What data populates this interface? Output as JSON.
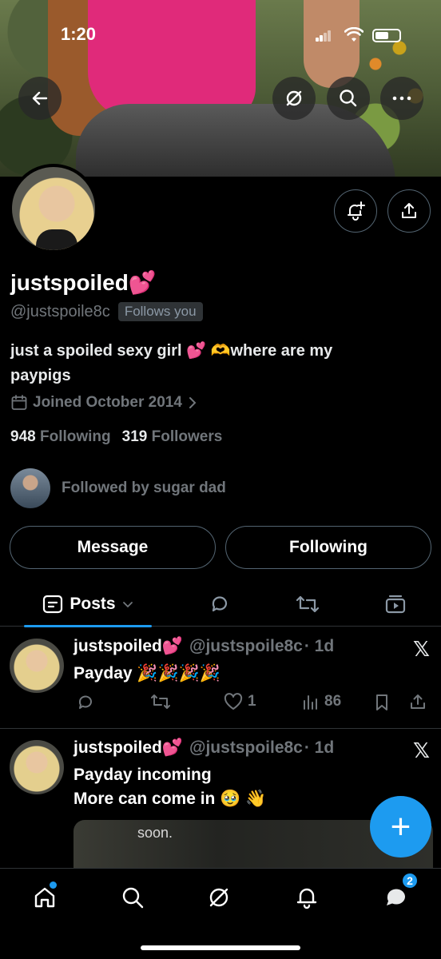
{
  "status_bar": {
    "time": "1:20"
  },
  "profile": {
    "display_name": "justspoiled💕",
    "handle": "@justspoile8c",
    "follows_you": "Follows you",
    "bio_line1": "just a spoiled sexy girl 💕 🫶where are my",
    "bio_line2": "paypigs",
    "joined": "Joined October 2014",
    "following_count": "948",
    "following_label": "Following",
    "followers_count": "319",
    "followers_label": "Followers",
    "followed_by": "Followed by sugar dad"
  },
  "buttons": {
    "message": "Message",
    "following": "Following"
  },
  "tabs": {
    "posts": "Posts"
  },
  "posts": [
    {
      "name": "justspoiled💕",
      "handle": "@justspoile8c",
      "time": "· 1d",
      "text": "Payday 🎉🎉🎉🎉",
      "likes": "1",
      "views": "86"
    },
    {
      "name": "justspoiled💕",
      "handle": "@justspoile8c",
      "time": "· 1d",
      "text_line1": "Payday incoming",
      "text_line2": "More can come in 🥹 👋",
      "media_caption": "soon."
    }
  ],
  "fab": {
    "label": "+"
  },
  "nav": {
    "messages_badge": "2"
  },
  "colors": {
    "accent": "#1d9bf0",
    "background": "#000000",
    "muted": "#71767b"
  }
}
